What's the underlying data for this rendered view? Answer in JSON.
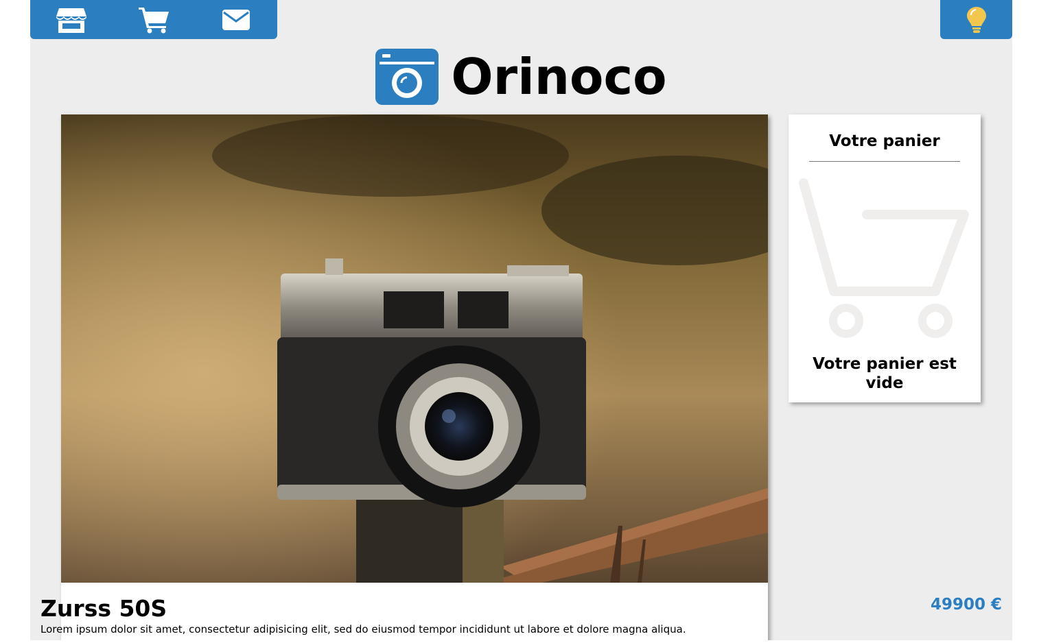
{
  "nav": {
    "items": [
      {
        "name": "store",
        "icon": "store-icon"
      },
      {
        "name": "cart",
        "icon": "shopping-cart-icon"
      },
      {
        "name": "contact",
        "icon": "envelope-icon"
      }
    ],
    "theme_toggle_icon": "lightbulb-icon"
  },
  "brand": {
    "title": "Orinoco",
    "logo_icon": "camera-icon"
  },
  "product": {
    "name": "Zurss 50S",
    "price": "49900 €",
    "description": "Lorem ipsum dolor sit amet, consectetur adipisicing elit, sed do eiusmod tempor incididunt ut labore et dolore magna aliqua."
  },
  "cart": {
    "title": "Votre panier",
    "empty_message": "Votre panier est vide",
    "empty_icon": "empty-cart-icon"
  },
  "colors": {
    "accent": "#2b7fc0",
    "bulb": "#f3c64d",
    "background": "#ededee",
    "price": "#2b7fc0"
  }
}
